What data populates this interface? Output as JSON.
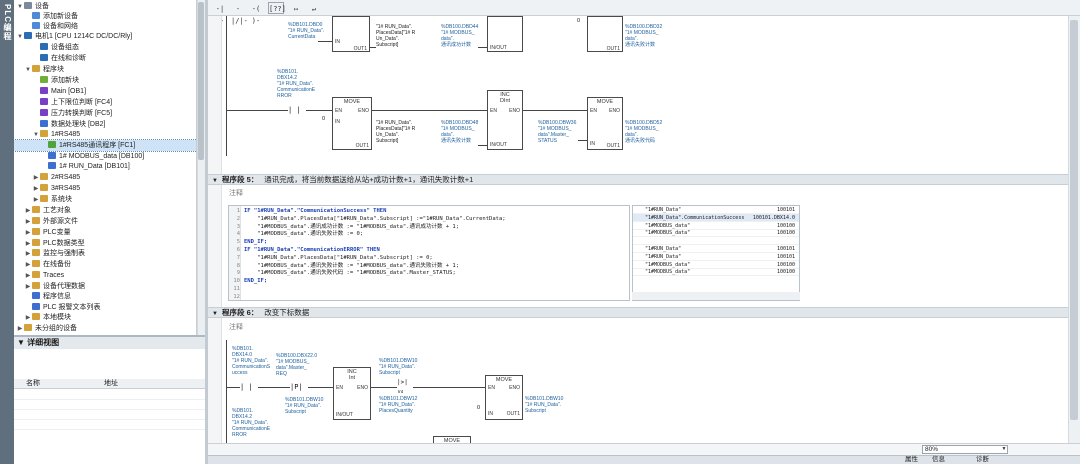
{
  "side_tab": "PLC编程",
  "tree": {
    "items": [
      {
        "label": "设备",
        "arrow": "▼"
      },
      {
        "label": "添加新设备",
        "arrow": ""
      },
      {
        "label": "设备和网络",
        "arrow": ""
      },
      {
        "label": "电机1 [CPU 1214C DC/DC/Rly]",
        "arrow": "▼"
      },
      {
        "label": "设备组态",
        "arrow": ""
      },
      {
        "label": "在线和诊断",
        "arrow": ""
      },
      {
        "label": "程序块",
        "arrow": "▼"
      },
      {
        "label": "添加新块",
        "arrow": ""
      },
      {
        "label": "Main [OB1]",
        "arrow": ""
      },
      {
        "label": "上下限位判断 [FC4]",
        "arrow": ""
      },
      {
        "label": "压力转换判断 [FC5]",
        "arrow": ""
      },
      {
        "label": "数据处理块 [DB2]",
        "arrow": ""
      },
      {
        "label": "1#RS485",
        "arrow": "▼"
      },
      {
        "label": "1#RS485通讯程序 [FC1]",
        "arrow": ""
      },
      {
        "label": "1# MODBUS_data [DB100]",
        "arrow": ""
      },
      {
        "label": "1# RUN_Data [DB101]",
        "arrow": ""
      },
      {
        "label": "2#RS485",
        "arrow": "▶"
      },
      {
        "label": "3#RS485",
        "arrow": "▶"
      },
      {
        "label": "系统块",
        "arrow": "▶"
      },
      {
        "label": "工艺对象",
        "arrow": "▶"
      },
      {
        "label": "外部源文件",
        "arrow": "▶"
      },
      {
        "label": "PLC变量",
        "arrow": "▶"
      },
      {
        "label": "PLC数据类型",
        "arrow": "▶"
      },
      {
        "label": "监控与强制表",
        "arrow": "▶"
      },
      {
        "label": "在线备份",
        "arrow": "▶"
      },
      {
        "label": "Traces",
        "arrow": "▶"
      },
      {
        "label": "设备代理数据",
        "arrow": "▶"
      },
      {
        "label": "程序信息",
        "arrow": ""
      },
      {
        "label": "PLC 报警文本列表",
        "arrow": ""
      },
      {
        "label": "本地模块",
        "arrow": "▶"
      },
      {
        "label": "未分组的设备",
        "arrow": "▶"
      }
    ]
  },
  "detail_view": {
    "title": "▼ 详细视图",
    "col_name": "名称",
    "col_address": "地址"
  },
  "toolbar": {
    "icons": [
      "-| |-",
      "-|/|-",
      "-( )-",
      "[??]",
      "↦",
      "↵"
    ]
  },
  "network4": {
    "top_op1": "%DB101.DBD0\n\"1# RUN_Data\".\nCurrentData",
    "top_op2": "\"1# RUN_Data\".\nPlacesData[\"1# R\nUn_Data\".\nSubscript]",
    "top_op3": "%DB100.DBD44\n\"1# MODBUS_\ndata\".\n通讯成功计数",
    "top_op4": "0",
    "top_op5": "%DB100.DBD32\n\"1# MODBUS_\ndata\".\n通讯失败计数",
    "contact_op": "%DB101.\nDBX14.2\n\"1# RUN_Data\".\nCommunicationE\nRROR",
    "move_in": "0",
    "r2_op1": "\"1# RUN_Data\".\nPlacesData[\"1# R\nUn_Data\".\nSubscript]",
    "r2_op2": "%DB100.DBD48\n\"1# MODBUS_\ndata\".\n通讯失败计数",
    "r2_op3": "%DB100.DBW36\n\"1# MODBUS_\ndata\".Master_\nSTATUS",
    "r2_op4": "%DB100.DBD52\n\"1# MODBUS_\ndata\".\n通讯失败代码",
    "move": "MOVE",
    "inc": "INC",
    "inc_type": "DInt",
    "en": "EN",
    "eno": "ENO",
    "in": "IN",
    "out1": "OUT1",
    "inout": "IN/OUT"
  },
  "network5": {
    "label": "程序段 5：",
    "description": "通讯完成，将当前数据送给从站+成功计数+1，通讯失败计数+1",
    "comment": "注释",
    "code": [
      "IF \"1#RUN_Data\".\"CommunicationSuccess\" THEN",
      "    \"1#RUN_Data\".PlacesData[\"1#RUN_Data\".Subscript] :=\"1#RUN_Data\".CurrentData;",
      "    \"1#MODBUS_data\".通讯成功计数 := \"1#MODBUS_data\".通讯成功计数 + 1;",
      "    \"1#MODBUS_data\".通讯失败计数 := 0;",
      "END_IF;",
      "IF \"1#RUN_Data\".\"CommunicationERROR\" THEN",
      "    \"1#RUN_Data\".PlacesData[\"1#RUN_Data\".Subscript] := 0;",
      "    \"1#MODBUS_data\".通讯失败计数 := \"1#MODBUS_data\".通讯失败计数 + 1;",
      "    \"1#MODBUS_data\".通讯失败代码 := \"1#MODBUS_data\".Master_STATUS;",
      "END_IF;",
      "",
      ""
    ],
    "line_numbers": [
      "1",
      "2",
      "3",
      "4",
      "5",
      "6",
      "7",
      "8",
      "9",
      "10",
      "11",
      "12"
    ],
    "watch": [
      {
        "name": "\"1#RUN_Data\"",
        "value": "100101"
      },
      {
        "name": "\"1#RUN_Data\".CommunicationSuccess",
        "value": "100101.DBX14.0"
      },
      {
        "name": "\"1#MODBUS_data\"",
        "value": "100100"
      },
      {
        "name": "\"1#MODBUS_data\"",
        "value": "100100"
      },
      {
        "name": "",
        "value": ""
      },
      {
        "name": "\"1#RUN_Data\"",
        "value": "100101"
      },
      {
        "name": "\"1#RUN_Data\"",
        "value": "100101"
      },
      {
        "name": "\"1#MODBUS_data\"",
        "value": "100100"
      },
      {
        "name": "\"1#MODBUS_data\"",
        "value": "100100"
      }
    ]
  },
  "network6": {
    "label": "程序段 6：",
    "description": "改变下标数据",
    "comment": "注释",
    "c1_op": "%DB101.\nDBX14.0\n\"1# RUN_Data\".\nCommunicationS\nuccess",
    "c2_op": "%DB100.DBX22.0\n\"1# MODBUS_\ndata\".Master_\nREQ",
    "c2_bottom": "%DB101.DBW10\n\"1# RUN_Data\".\nSubscript",
    "edge": "P",
    "inc": "INC",
    "inc_type": "Int",
    "cmp_top": "%DB101.DBW10\n\"1# RUN_Data\".\nSubscript",
    "cmp_symbol": ">",
    "cmp_type": "Int",
    "cmp_bottom": "%DB101.DBW12\n\"1# RUN_Data\".\nPlacesQuantity",
    "move": "MOVE",
    "move_in": "0",
    "move_out": "%DB101.DBW10\n\"1# RUN_Data\".\nSubscript",
    "c3_op": "%DB101.\nDBX14.2\n\"1# RUN_Data\".\nCommunicationE\nRROR"
  },
  "zoom": "80%",
  "status_tabs": [
    "属性",
    "信息",
    "诊断"
  ]
}
